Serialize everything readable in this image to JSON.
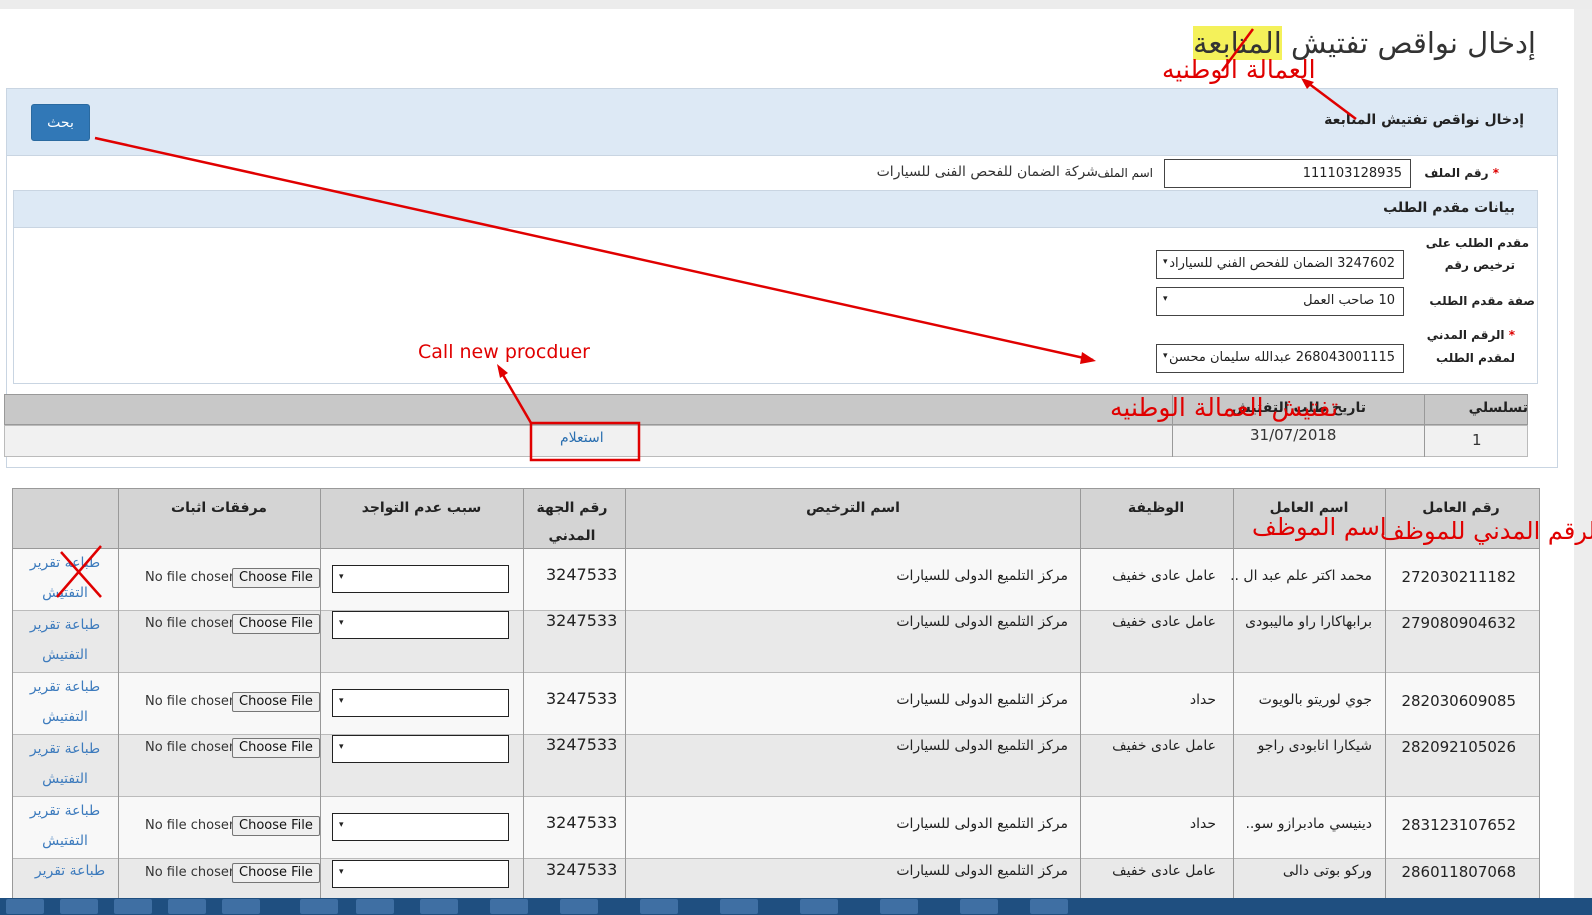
{
  "page": {
    "title_main": "إدخال نواقص تفتيش ",
    "title_highlight": "المتابعة"
  },
  "panel": {
    "title": "إدخال نواقص تفتيش المتابعة",
    "search_button": "بحث"
  },
  "file": {
    "number_label": "رقم الملف",
    "required_mark": "*",
    "number_value": "111103128935",
    "name_label": "اسم الملف",
    "name_value": "شركة الضمان للفحص الفنى للسيارات"
  },
  "applicant": {
    "section_title": "بيانات مقدم الطلب",
    "license_label_1": "مقدم الطلب على",
    "license_label_2": "ترخيص رقم",
    "license_value": "3247602 الضمان للفحص الفني للسياراد",
    "role_label": "صفة مقدم الطلب",
    "role_value": "10 صاحب العمل",
    "civil_label_1": "الرقم المدني",
    "civil_label_2": "لمقدم الطلب",
    "civil_value": "268043001115 عبدالله سليمان محسن"
  },
  "requests_table": {
    "headers": [
      "تسلسلي",
      "تاريخ طلب التفتيش"
    ],
    "rows": [
      {
        "serial": "1",
        "date": "31/07/2018",
        "action": "استعلام"
      }
    ]
  },
  "workers_table": {
    "headers": [
      "رقم العامل",
      "اسم العامل",
      "الوظيفة",
      "اسم الترخيص",
      "رقم الجهة المدني",
      "سبب عدم التواجد",
      "مرفقات اثبات"
    ],
    "file_status": "No file chosen",
    "choose_label": "Choose File",
    "print_label": "طباعة تقرير التفتيش",
    "print_label_partial": "طباعة تقرير",
    "select_arrow": "▾",
    "rows": [
      {
        "id": "272030211182",
        "name": "محمد اكتر علم عبد ال ..",
        "job": "عامل عادى خفيف",
        "license": "مركز التلميع الدولى للسيارات",
        "civil": "3247533"
      },
      {
        "id": "279080904632",
        "name": "برابهاكارا راو ماليبودى",
        "job": "عامل عادى خفيف",
        "license": "مركز التلميع الدولى للسيارات",
        "civil": "3247533"
      },
      {
        "id": "282030609085",
        "name": "جوي لوريتو بالويوت",
        "job": "حداد",
        "license": "مركز التلميع الدولى للسيارات",
        "civil": "3247533"
      },
      {
        "id": "282092105026",
        "name": "شيكارا انابودى راجو",
        "job": "عامل عادى خفيف",
        "license": "مركز التلميع الدولى للسيارات",
        "civil": "3247533"
      },
      {
        "id": "283123107652",
        "name": "دينيسي مادبرازو سو..",
        "job": "حداد",
        "license": "مركز التلميع الدولى للسيارات",
        "civil": "3247533"
      },
      {
        "id": "286011807068",
        "name": "وركو بوتى دالى",
        "job": "عامل عادى خفيف",
        "license": "مركز التلميع الدولى للسيارات",
        "civil": "3247533"
      }
    ]
  },
  "annotations": {
    "national_labor_title": "العمالة الوطنيه",
    "national_labor_table": "تفتيش العمالة الوطنيه",
    "call_new_procedure": "Call new procduer",
    "employee_name": "اسم الموظف",
    "employee_civil_id": "الرقم المدني للموظف",
    "color": "#e00000"
  },
  "colors": {
    "accent": "#3178b7",
    "panel_header": "#dde9f5",
    "highlight": "#f4f15a",
    "link": "#3d7bbd"
  }
}
